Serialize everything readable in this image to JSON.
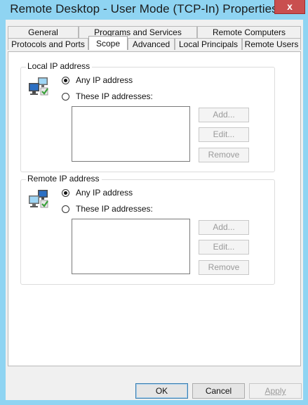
{
  "window": {
    "title": "Remote Desktop - User Mode (TCP-In) Properties",
    "close_glyph": "x"
  },
  "tabs_top": [
    "General",
    "Programs and Services",
    "Remote Computers"
  ],
  "tabs_bottom": [
    "Protocols and Ports",
    "Scope",
    "Advanced",
    "Local Principals",
    "Remote Users"
  ],
  "selected_tab": "Scope",
  "local": {
    "legend": "Local IP address",
    "any_label": "Any IP address",
    "these_label": "These IP addresses:",
    "selected": "any",
    "add": "Add...",
    "edit": "Edit...",
    "remove": "Remove"
  },
  "remote": {
    "legend": "Remote IP address",
    "any_label": "Any IP address",
    "these_label": "These IP addresses:",
    "selected": "any",
    "add": "Add...",
    "edit": "Edit...",
    "remove": "Remove"
  },
  "buttons": {
    "ok": "OK",
    "cancel": "Cancel",
    "apply": "Apply"
  }
}
